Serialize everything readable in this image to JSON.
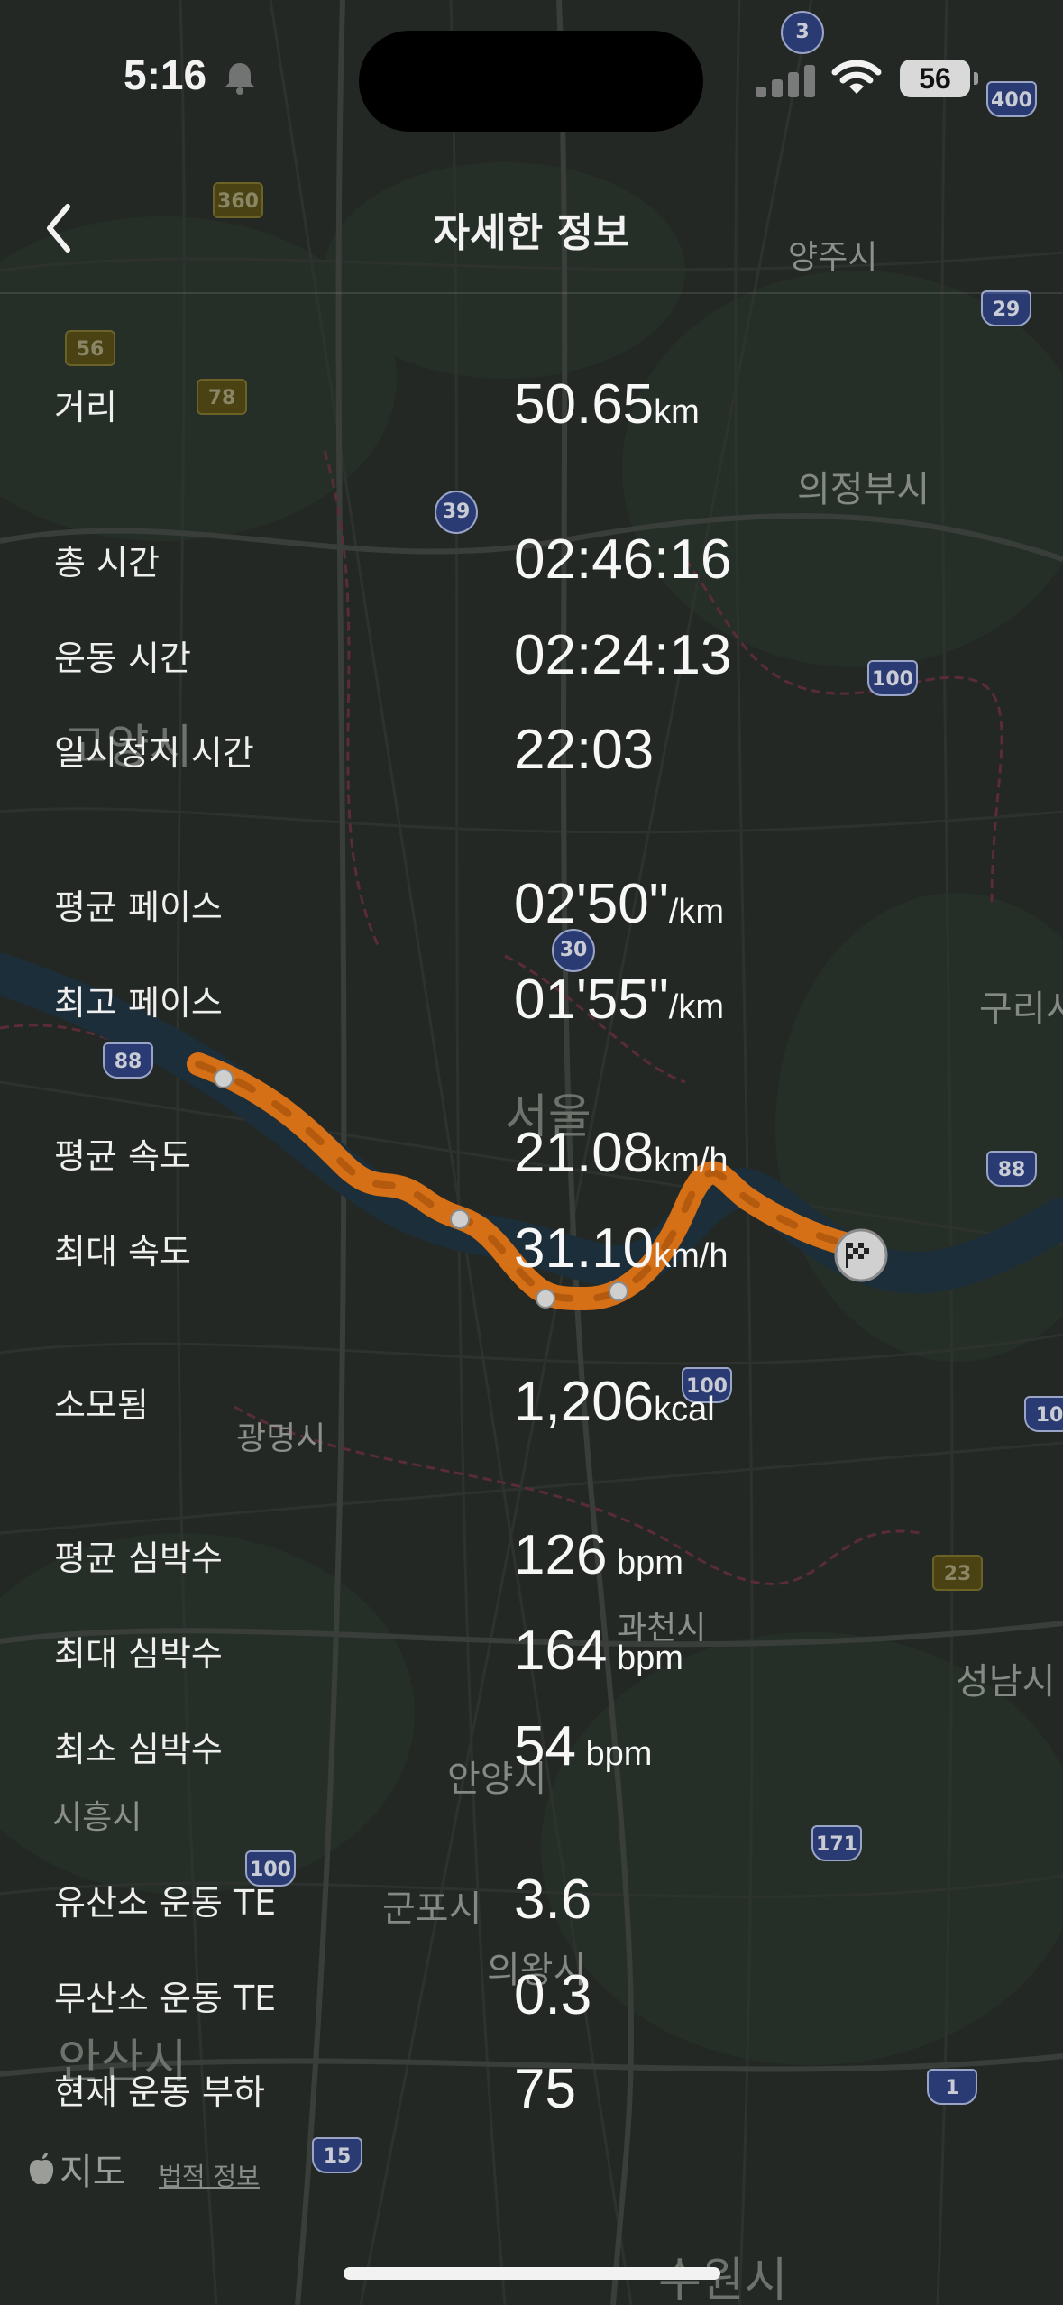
{
  "status_bar": {
    "time": "5:16",
    "battery": "56"
  },
  "nav": {
    "title": "자세한 정보"
  },
  "stats": [
    {
      "label": "거리",
      "value": "50.65",
      "unit": "km"
    },
    {
      "label": "총 시간",
      "value": "02:46:16",
      "unit": ""
    },
    {
      "label": "운동 시간",
      "value": "02:24:13",
      "unit": ""
    },
    {
      "label": "일시정지 시간",
      "value": "22:03",
      "unit": ""
    },
    {
      "label": "평균 페이스",
      "value": "02'50\"",
      "unit": "/km"
    },
    {
      "label": "최고 페이스",
      "value": "01'55\"",
      "unit": "/km"
    },
    {
      "label": "평균 속도",
      "value": "21.08",
      "unit": "km/h"
    },
    {
      "label": "최대 속도",
      "value": "31.10",
      "unit": "km/h"
    },
    {
      "label": "소모됨",
      "value": "1,206",
      "unit": "kcal"
    },
    {
      "label": "평균 심박수",
      "value": "126",
      "unit": " bpm"
    },
    {
      "label": "최대 심박수",
      "value": "164",
      "unit": " bpm"
    },
    {
      "label": "최소 심박수",
      "value": "54",
      "unit": " bpm"
    },
    {
      "label": "유산소 운동 TE",
      "value": "3.6",
      "unit": ""
    },
    {
      "label": "무산소 운동 TE",
      "value": "0.3",
      "unit": ""
    },
    {
      "label": "현재 운동 부하",
      "value": "75",
      "unit": ""
    }
  ],
  "map": {
    "places": [
      "양주시",
      "의정부시",
      "구리시",
      "서울",
      "광명시",
      "과천시",
      "성남시",
      "안양시",
      "시흥시",
      "군포시",
      "의왕시",
      "안산시",
      "수원시",
      "고양시"
    ],
    "road_shields": [
      "3",
      "400",
      "360",
      "56",
      "78",
      "39",
      "29",
      "100",
      "30",
      "88",
      "88",
      "10",
      "23",
      "100",
      "171",
      "1",
      "15",
      "100"
    ],
    "attribution": "지도",
    "legal": "법적 정보"
  },
  "colors": {
    "route": "#e07818",
    "background": "#222724",
    "text": "#f2f2f2"
  }
}
